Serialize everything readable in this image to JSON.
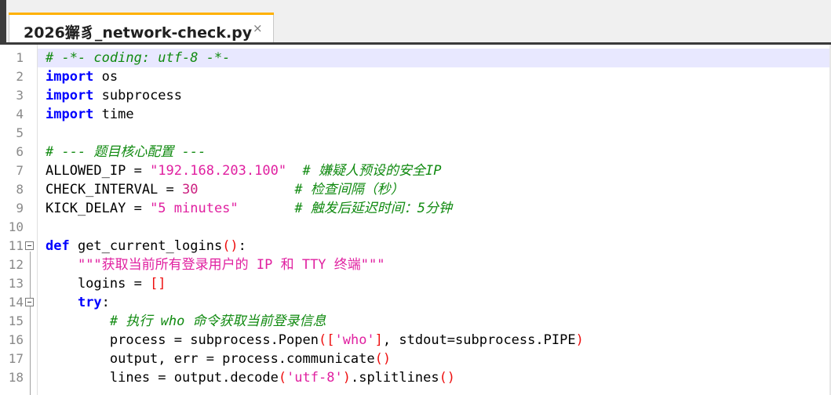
{
  "tab": {
    "title": "2026獬豸_network-check.py",
    "close": "×"
  },
  "editor": {
    "lines": [
      {
        "n": "1",
        "fold": false,
        "tokens": [
          {
            "c": "com",
            "t": "# -*- coding: utf-8 -*-"
          }
        ]
      },
      {
        "n": "2",
        "fold": false,
        "tokens": [
          {
            "c": "kw",
            "t": "import"
          },
          {
            "c": "id",
            "t": " os"
          }
        ]
      },
      {
        "n": "3",
        "fold": false,
        "tokens": [
          {
            "c": "kw",
            "t": "import"
          },
          {
            "c": "id",
            "t": " subprocess"
          }
        ]
      },
      {
        "n": "4",
        "fold": false,
        "tokens": [
          {
            "c": "kw",
            "t": "import"
          },
          {
            "c": "id",
            "t": " time"
          }
        ]
      },
      {
        "n": "5",
        "fold": false,
        "tokens": []
      },
      {
        "n": "6",
        "fold": false,
        "tokens": [
          {
            "c": "com",
            "t": "# --- 题目核心配置 ---"
          }
        ]
      },
      {
        "n": "7",
        "fold": false,
        "tokens": [
          {
            "c": "id",
            "t": "ALLOWED_IP = "
          },
          {
            "c": "str",
            "t": "\"192.168.203.100\""
          },
          {
            "c": "id",
            "t": "  "
          },
          {
            "c": "com",
            "t": "# 嫌疑人预设的安全IP"
          }
        ]
      },
      {
        "n": "8",
        "fold": false,
        "tokens": [
          {
            "c": "id",
            "t": "CHECK_INTERVAL = "
          },
          {
            "c": "num",
            "t": "30"
          },
          {
            "c": "id",
            "t": "            "
          },
          {
            "c": "com",
            "t": "# 检查间隔（秒）"
          }
        ]
      },
      {
        "n": "9",
        "fold": false,
        "tokens": [
          {
            "c": "id",
            "t": "KICK_DELAY = "
          },
          {
            "c": "str",
            "t": "\"5 minutes\""
          },
          {
            "c": "id",
            "t": "       "
          },
          {
            "c": "com",
            "t": "# 触发后延迟时间：5分钟"
          }
        ]
      },
      {
        "n": "10",
        "fold": false,
        "tokens": []
      },
      {
        "n": "11",
        "fold": true,
        "tokens": [
          {
            "c": "kw",
            "t": "def"
          },
          {
            "c": "id",
            "t": " get_current_logins"
          },
          {
            "c": "op",
            "t": "()"
          },
          {
            "c": "id",
            "t": ":"
          }
        ]
      },
      {
        "n": "12",
        "fold": false,
        "tokens": [
          {
            "c": "id",
            "t": "    "
          },
          {
            "c": "str",
            "t": "\"\"\"获取当前所有登录用户的 IP 和 TTY 终端\"\"\""
          }
        ]
      },
      {
        "n": "13",
        "fold": false,
        "tokens": [
          {
            "c": "id",
            "t": "    logins = "
          },
          {
            "c": "op",
            "t": "[]"
          }
        ]
      },
      {
        "n": "14",
        "fold": true,
        "tokens": [
          {
            "c": "id",
            "t": "    "
          },
          {
            "c": "kw",
            "t": "try"
          },
          {
            "c": "id",
            "t": ":"
          }
        ]
      },
      {
        "n": "15",
        "fold": false,
        "tokens": [
          {
            "c": "id",
            "t": "        "
          },
          {
            "c": "com",
            "t": "# 执行 who 命令获取当前登录信息"
          }
        ]
      },
      {
        "n": "16",
        "fold": false,
        "tokens": [
          {
            "c": "id",
            "t": "        process = subprocess.Popen"
          },
          {
            "c": "op",
            "t": "(["
          },
          {
            "c": "str",
            "t": "'who'"
          },
          {
            "c": "op",
            "t": "]"
          },
          {
            "c": "id",
            "t": ", stdout=subprocess.PIPE"
          },
          {
            "c": "op",
            "t": ")"
          }
        ]
      },
      {
        "n": "17",
        "fold": false,
        "tokens": [
          {
            "c": "id",
            "t": "        output, err = process.communicate"
          },
          {
            "c": "op",
            "t": "()"
          }
        ]
      },
      {
        "n": "18",
        "fold": false,
        "tokens": [
          {
            "c": "id",
            "t": "        lines = output.decode"
          },
          {
            "c": "op",
            "t": "("
          },
          {
            "c": "str",
            "t": "'utf-8'"
          },
          {
            "c": "op",
            "t": ")"
          },
          {
            "c": "id",
            "t": ".splitlines"
          },
          {
            "c": "op",
            "t": "()"
          }
        ]
      }
    ]
  }
}
